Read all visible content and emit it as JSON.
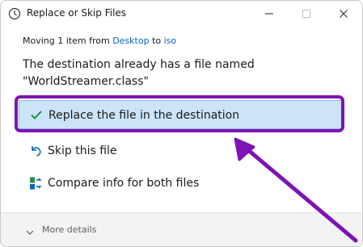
{
  "window": {
    "title": "Replace or Skip Files"
  },
  "moving": {
    "prefix": "Moving 1 item from",
    "source": "Desktop",
    "connector": "to",
    "destination": "iso"
  },
  "message": {
    "line1": "The destination already has a file named",
    "line2": "\"WorldStreamer.class\""
  },
  "options": {
    "replace": {
      "label": "Replace the file in the destination",
      "icon": "checkmark-icon"
    },
    "skip": {
      "label": "Skip this file",
      "icon": "undo-arrow-icon"
    },
    "compare": {
      "label": "Compare info for both files",
      "icon": "compare-icon"
    }
  },
  "footer": {
    "more_details": "More details"
  },
  "colors": {
    "highlight": "#7d14b4",
    "selected_bg": "#cce4f7",
    "link": "#0067c0"
  }
}
